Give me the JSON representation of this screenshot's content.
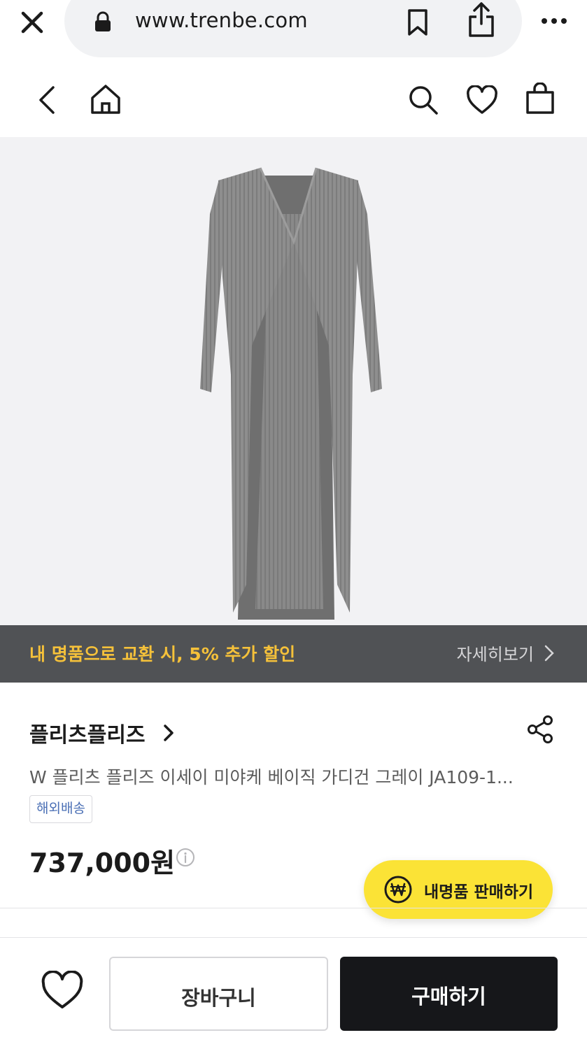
{
  "browser": {
    "url": "www.trenbe.com",
    "icons": [
      "close-icon",
      "lock-icon",
      "bookmark-icon",
      "share-icon",
      "more-icon"
    ]
  },
  "header": {
    "icons": [
      "back-icon",
      "home-icon",
      "search-icon",
      "heart-icon",
      "shopping-bag-icon"
    ]
  },
  "product_image": {
    "garment_color": "#8a8a8a",
    "background": "#f2f2f4"
  },
  "promo": {
    "text": "내 명품으로 교환 시, 5% 추가 할인",
    "link_label": "자세히보기",
    "text_color": "#f5c13a",
    "background": "#505255"
  },
  "product": {
    "brand": "플리츠플리즈",
    "title": "W 플리츠 플리즈 이세이 미야케 베이직 가디건 그레이 JA109-1...",
    "badge": "해외배송",
    "price": "737,000원"
  },
  "sell_button": {
    "label": "내명품 판매하기",
    "color": "#fbe336"
  },
  "bottom_bar": {
    "cart_label": "장바구니",
    "buy_label": "구매하기"
  }
}
